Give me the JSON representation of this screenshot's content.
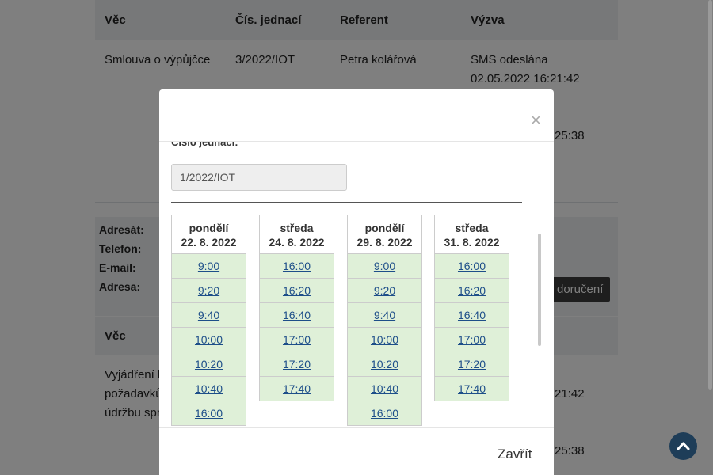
{
  "table": {
    "headers": [
      "Věc",
      "Čís. jednací",
      "Referent",
      "Výzva"
    ],
    "row1": {
      "vec": "Smlouva o výpůjčce",
      "cislo": "3/2022/IOT",
      "referent": "Petra kolářová",
      "vyzva_line1": "SMS odeslána",
      "vyzva_line2": "02.05.2022 16:21:42",
      "vyzva_line3": "25:38"
    }
  },
  "contact": {
    "labels": [
      "Adresát:",
      "Telefon:",
      "E-mail:",
      "Adresa:"
    ],
    "button": "doručení"
  },
  "table2": {
    "header": "Věc",
    "row": {
      "vec_lines": [
        "Vyjádření k",
        "požadavků",
        "údržbu spr"
      ],
      "vyzva_line1": "21:42",
      "vyzva_line2": "25:38"
    }
  },
  "modal": {
    "close_symbol": "×",
    "cut_label": "Číslo jednací:",
    "ref_value": "1/2022/IOT",
    "days": [
      {
        "name": "pondělí",
        "date": "22. 8. 2022",
        "slots": [
          "9:00",
          "9:20",
          "9:40",
          "10:00",
          "10:20",
          "10:40",
          "16:00"
        ]
      },
      {
        "name": "středa",
        "date": "24. 8. 2022",
        "slots": [
          "16:00",
          "16:20",
          "16:40",
          "17:00",
          "17:20",
          "17:40"
        ]
      },
      {
        "name": "pondělí",
        "date": "29. 8. 2022",
        "slots": [
          "9:00",
          "9:20",
          "9:40",
          "10:00",
          "10:20",
          "10:40",
          "16:00"
        ]
      },
      {
        "name": "středa",
        "date": "31. 8. 2022",
        "slots": [
          "16:00",
          "16:20",
          "16:40",
          "17:00",
          "17:20",
          "17:40"
        ]
      }
    ],
    "close_button": "Zavřít"
  },
  "scroll_top_icon": "chevron-up-icon",
  "colors": {
    "slot_bg": "#dff0d8",
    "link": "#1d4e89",
    "back_to_top": "#1e3d58",
    "header_bg": "#eef0f2"
  }
}
